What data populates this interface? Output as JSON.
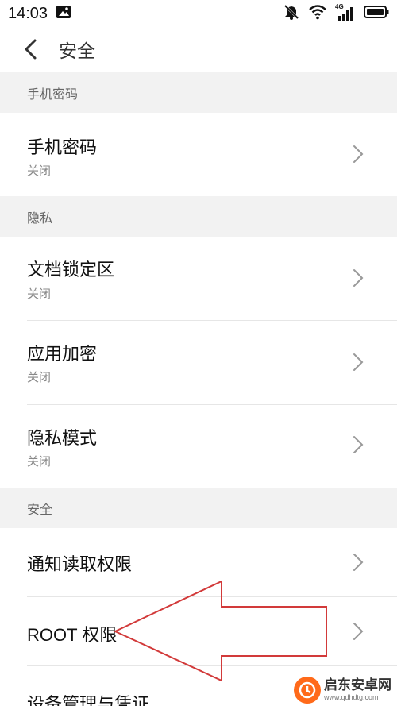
{
  "status_bar": {
    "time": "14:03",
    "left_icons": [
      "image-icon"
    ],
    "right_icons": [
      "mute-icon",
      "wifi-icon",
      "signal-4g-icon",
      "battery-icon"
    ],
    "network_label": "4G"
  },
  "header": {
    "title": "安全",
    "back_icon": "chevron-left-icon"
  },
  "sections": [
    {
      "header": "手机密码",
      "items": [
        {
          "title": "手机密码",
          "subtitle": "关闭"
        }
      ]
    },
    {
      "header": "隐私",
      "items": [
        {
          "title": "文档锁定区",
          "subtitle": "关闭"
        },
        {
          "title": "应用加密",
          "subtitle": "关闭"
        },
        {
          "title": "隐私模式",
          "subtitle": "关闭"
        }
      ]
    },
    {
      "header": "安全",
      "items": [
        {
          "title": "通知读取权限",
          "subtitle": ""
        },
        {
          "title": "ROOT 权限",
          "subtitle": ""
        },
        {
          "title": "设备管理与凭证",
          "subtitle": ""
        }
      ]
    }
  ],
  "annotation": {
    "type": "arrow",
    "color": "#d23a3a",
    "points_to": "ROOT 权限"
  },
  "watermark": {
    "name": "启东安卓网",
    "url": "www.qdhdtg.com",
    "logo_color": "#ff6a1a"
  }
}
